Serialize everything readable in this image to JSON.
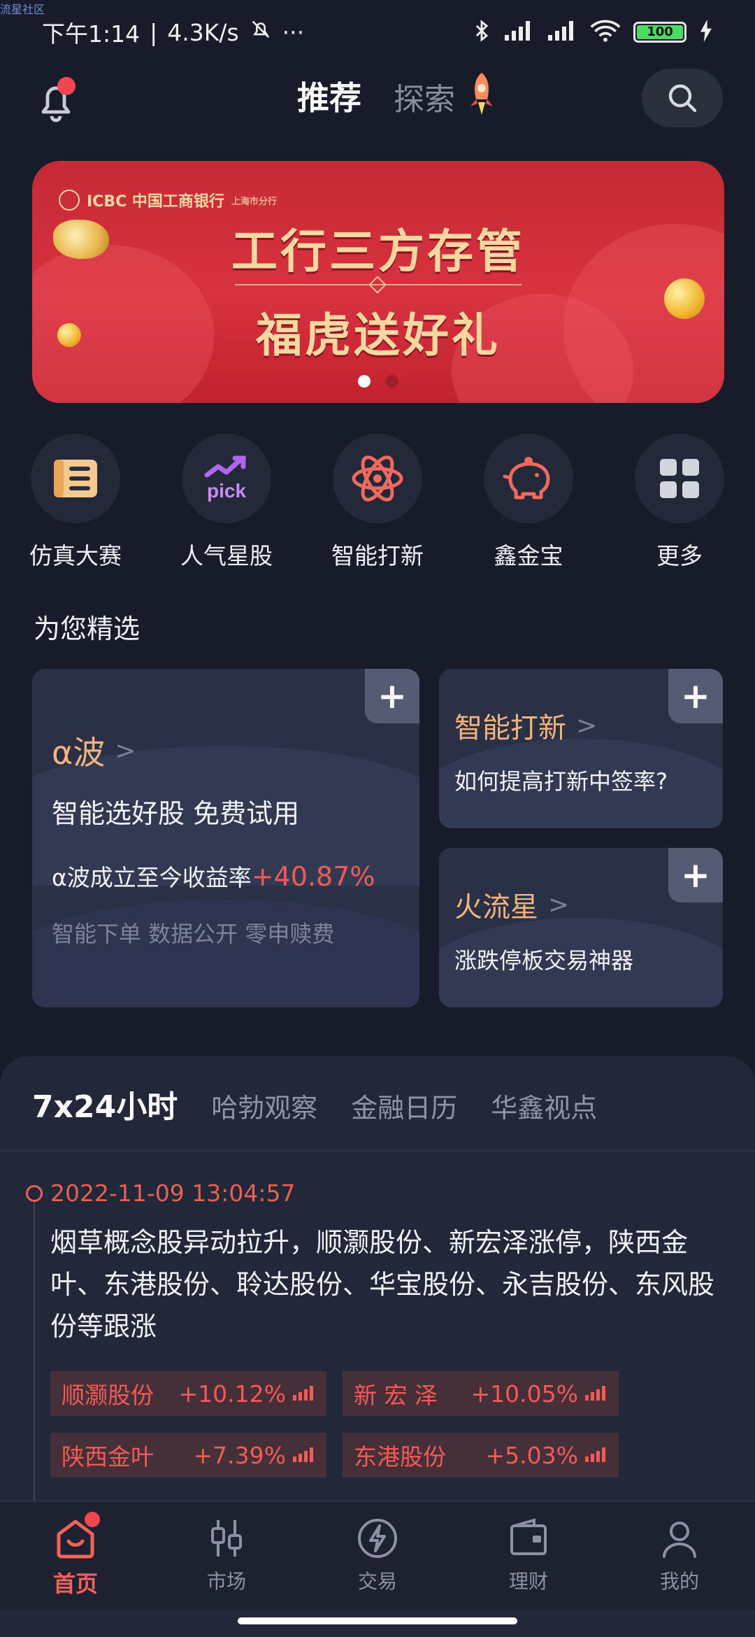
{
  "watermark": "流星社区",
  "status_bar": {
    "time": "下午1:14",
    "speed": "4.3K/s",
    "more": "···",
    "battery": "100"
  },
  "header": {
    "tab_recommend": "推荐",
    "tab_explore": "探索"
  },
  "banner": {
    "logo": "ICBC 中国工商银行",
    "logo_sub": "上海市分行",
    "line1": "工行三方存管",
    "line2": "福虎送好礼"
  },
  "shortcuts": [
    {
      "label": "仿真大赛",
      "icon": "list-icon"
    },
    {
      "label": "人气星股",
      "icon": "pick-icon"
    },
    {
      "label": "智能打新",
      "icon": "atom-icon"
    },
    {
      "label": "鑫金宝",
      "icon": "piggy-bank-icon"
    },
    {
      "label": "更多",
      "icon": "grid-icon"
    }
  ],
  "section": {
    "title": "为您精选"
  },
  "cards": {
    "alpha": {
      "title": "α波",
      "subtitle": "智能选好股 免费试用",
      "return_label": "α波成立至今收益率",
      "return_value": "+40.87%",
      "footnote": "智能下单 数据公开 零申赎费"
    },
    "ipo": {
      "title": "智能打新",
      "text": "如何提高打新中签率?"
    },
    "meteor": {
      "title": "火流星",
      "text": "涨跌停板交易神器"
    }
  },
  "news": {
    "tabs": [
      "7x24小时",
      "哈勃观察",
      "金融日历",
      "华鑫视点"
    ],
    "time": "2022-11-09 13:04:57",
    "body": "烟草概念股异动拉升，顺灏股份、新宏泽涨停，陕西金叶、东港股份、聆达股份、华宝股份、永吉股份、东风股份等跟涨",
    "stocks": [
      {
        "name": "顺灏股份",
        "pct": "+10.12%"
      },
      {
        "name": "新 宏 泽",
        "pct": "+10.05%"
      },
      {
        "name": "陕西金叶",
        "pct": "+7.39%"
      },
      {
        "name": "东港股份",
        "pct": "+5.03%"
      }
    ]
  },
  "nav": [
    {
      "label": "首页",
      "icon": "home-icon"
    },
    {
      "label": "市场",
      "icon": "market-icon"
    },
    {
      "label": "交易",
      "icon": "trade-icon"
    },
    {
      "label": "理财",
      "icon": "wallet-icon"
    },
    {
      "label": "我的",
      "icon": "profile-icon"
    }
  ],
  "colors": {
    "accent": "#f0625a",
    "gold": "#f2b37c",
    "background": "#181c2a",
    "up": "#f25a55"
  }
}
